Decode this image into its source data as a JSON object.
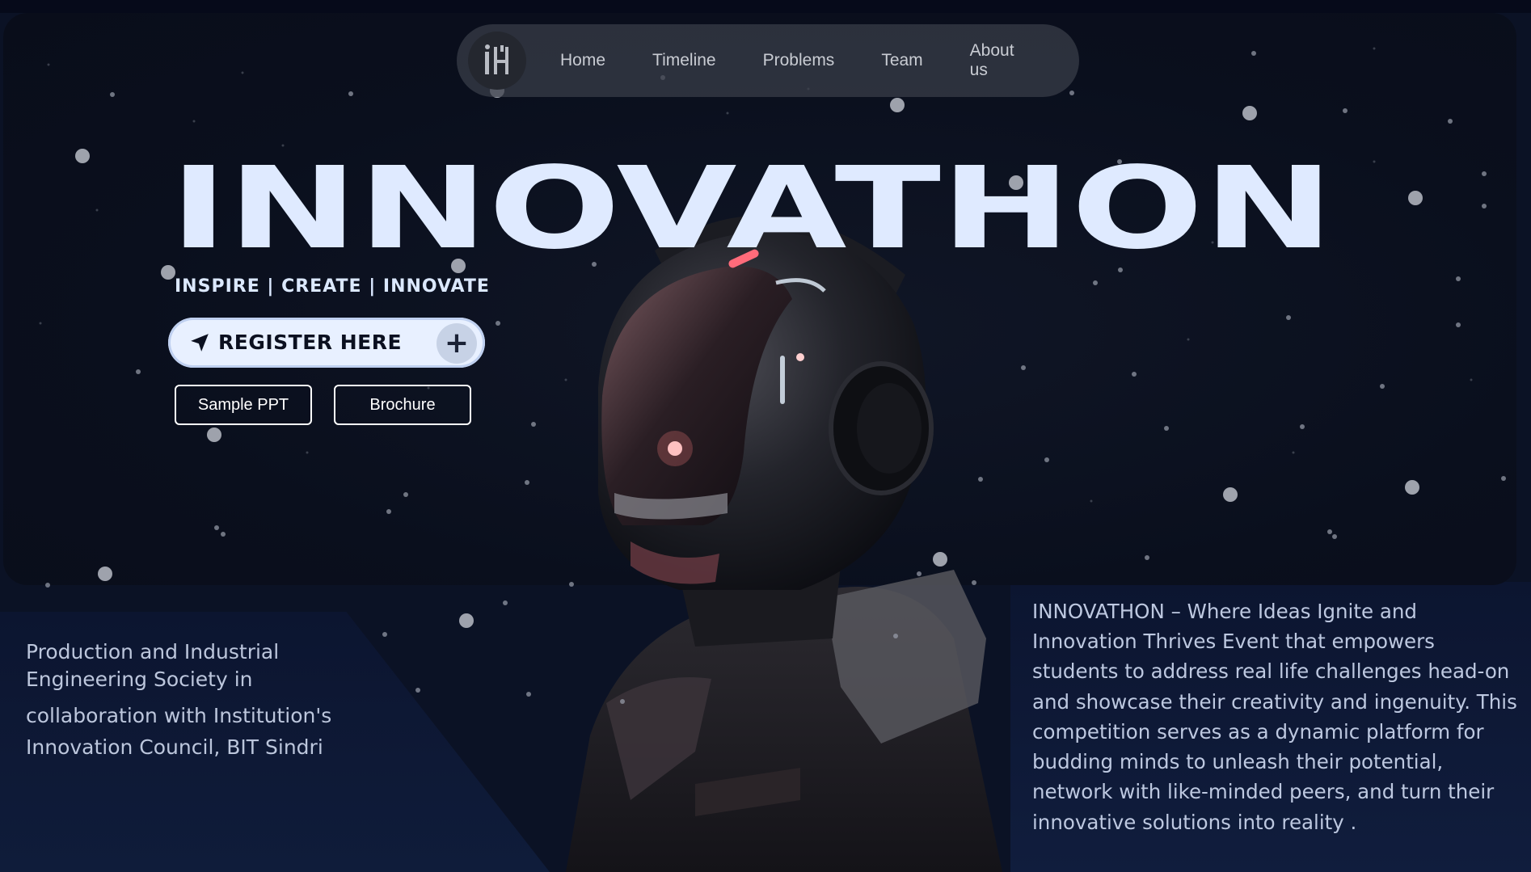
{
  "nav": {
    "logo_text": "iH",
    "links": [
      "Home",
      "Timeline",
      "Problems",
      "Team",
      "About us"
    ]
  },
  "hero": {
    "title": "INNOVATHON",
    "tagline": "INSPIRE | CREATE | INNOVATE",
    "register_label": "REGISTER HERE",
    "register_plus": "+",
    "sample_ppt_label": "Sample PPT",
    "brochure_label": "Brochure"
  },
  "organizer": {
    "lines": [
      "Production and Industrial",
      "Engineering Society in",
      "collaboration with Institution's",
      "Innovation Council, BIT Sindri"
    ]
  },
  "description": {
    "text": "INNOVATHON – Where Ideas Ignite and Innovation Thrives Event that empowers students to address real life challenges head-on and showcase their creativity and ingenuity. This competition serves as a dynamic platform for budding minds to unleash their potential, network with like-minded peers, and turn their innovative solutions into reality ."
  },
  "colors": {
    "background": "#0a0f1d",
    "accent": "#e8f0ff",
    "nav_bg": "#3a3e4a",
    "lower_panel": "#0f1c3a"
  },
  "icons": {
    "register": "navigation-arrow-icon",
    "plus": "plus-icon",
    "logo": "logo-icon"
  }
}
